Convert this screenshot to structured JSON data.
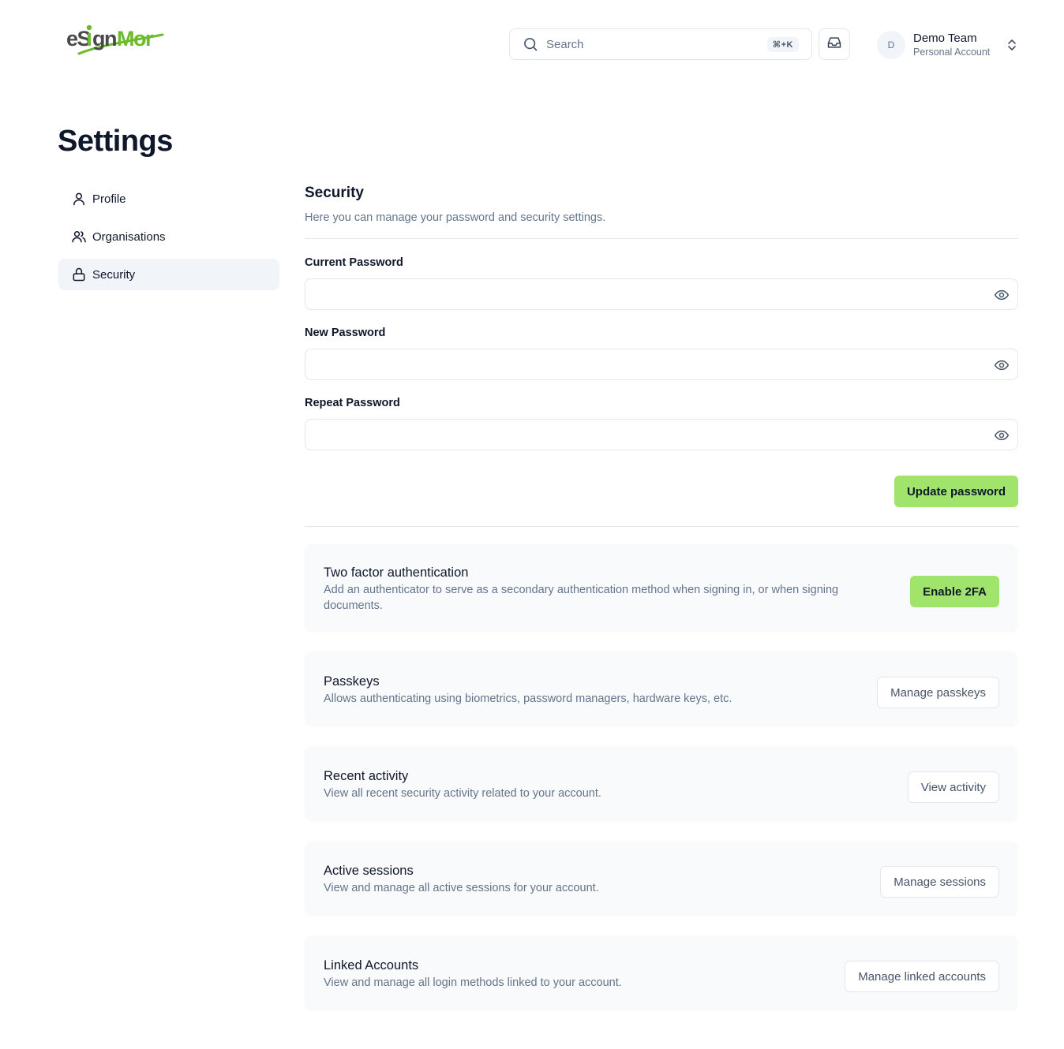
{
  "header": {
    "logo_alt": "eSignMor",
    "search": {
      "placeholder": "Search",
      "shortcut": "⌘+K"
    },
    "account": {
      "avatar_initial": "D",
      "name": "Demo Team",
      "subtitle": "Personal Account"
    }
  },
  "page": {
    "title": "Settings"
  },
  "sidebar": {
    "items": [
      {
        "label": "Profile",
        "icon": "user-icon"
      },
      {
        "label": "Organisations",
        "icon": "users-icon"
      },
      {
        "label": "Security",
        "icon": "lock-icon",
        "active": true
      }
    ]
  },
  "security": {
    "title": "Security",
    "description": "Here you can manage your password and security settings.",
    "fields": {
      "current": {
        "label": "Current Password",
        "value": ""
      },
      "new": {
        "label": "New Password",
        "value": ""
      },
      "repeat": {
        "label": "Repeat Password",
        "value": ""
      }
    },
    "update_button": "Update password"
  },
  "cards": {
    "two_factor": {
      "title": "Two factor authentication",
      "description": "Add an authenticator to serve as a secondary authentication method when signing in, or when signing documents.",
      "button": "Enable 2FA"
    },
    "passkeys": {
      "title": "Passkeys",
      "description": "Allows authenticating using biometrics, password managers, hardware keys, etc.",
      "button": "Manage passkeys"
    },
    "activity": {
      "title": "Recent activity",
      "description": "View all recent security activity related to your account.",
      "button": "View activity"
    },
    "sessions": {
      "title": "Active sessions",
      "description": "View and manage all active sessions for your account.",
      "button": "Manage sessions"
    },
    "linked": {
      "title": "Linked Accounts",
      "description": "View and manage all login methods linked to your account.",
      "button": "Manage linked accounts"
    }
  },
  "colors": {
    "accent_green": "#a1e46c",
    "text_primary": "#0f172a",
    "text_muted": "#64748b",
    "border": "#e2e8f0",
    "card_bg": "#f8fafc"
  }
}
